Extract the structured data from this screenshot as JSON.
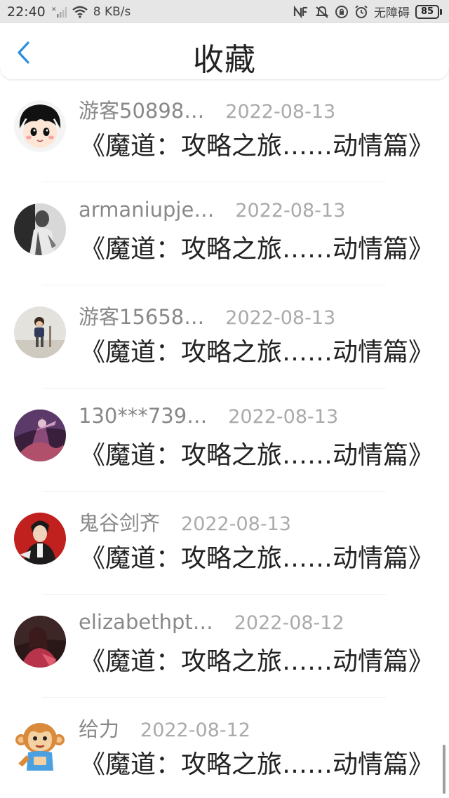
{
  "status_bar": {
    "time": "22:40",
    "net_speed": "8 KB/s",
    "ring_mode": "无障碍",
    "battery": "85"
  },
  "header": {
    "title": "收藏"
  },
  "colors": {
    "accent": "#2a8de0",
    "username": "#888888",
    "date": "#aaaaaa",
    "title_text": "#222222"
  },
  "favorites": [
    {
      "user": "游客50898…",
      "date": "2022-08-13",
      "title": "《魔道：攻略之旅……动情篇》",
      "avatar": "cartoon-boy-avatar"
    },
    {
      "user": "armaniupje…",
      "date": "2022-08-13",
      "title": "《魔道：攻略之旅……动情篇》",
      "avatar": "bw-photo-avatar"
    },
    {
      "user": "游客15658…",
      "date": "2022-08-13",
      "title": "《魔道：攻略之旅……动情篇》",
      "avatar": "child-photo-avatar"
    },
    {
      "user": "130***739…",
      "date": "2022-08-13",
      "title": "《魔道：攻略之旅……动情篇》",
      "avatar": "fantasy-art-avatar"
    },
    {
      "user": "鬼谷剑齐",
      "date": "2022-08-13",
      "title": "《魔道：攻略之旅……动情篇》",
      "avatar": "red-portrait-avatar"
    },
    {
      "user": "elizabethpt…",
      "date": "2022-08-12",
      "title": "《魔道：攻略之旅……动情篇》",
      "avatar": "dark-portrait-avatar"
    },
    {
      "user": "给力",
      "date": "2022-08-12",
      "title": "《魔道：攻略之旅……动情篇》",
      "avatar": "monkey-cartoon-avatar"
    }
  ]
}
